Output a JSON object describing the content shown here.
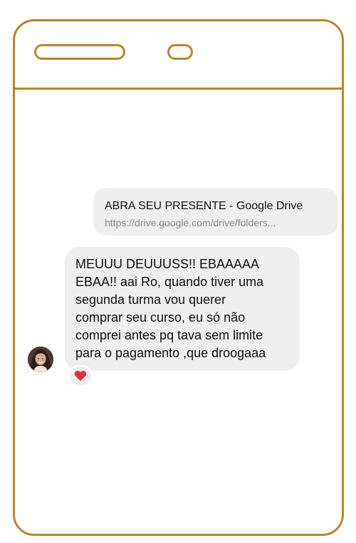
{
  "colors": {
    "frame": "#b8862a",
    "bubble": "#efefef",
    "text": "#111111",
    "secondary_text": "#8a8a8a",
    "heart": "#e0303e"
  },
  "phone": {
    "speaker_icon": "speaker-slot-icon",
    "camera_icon": "camera-slot-icon"
  },
  "chat": {
    "link_preview": {
      "title": "ABRA SEU PRESENTE - Google Drive",
      "url": "https://drive.google.com/drive/folders..."
    },
    "reply": {
      "text": "MEUUU DEUUUSS!! EBAAAAA\nEBAA!! aai Ro, quando tiver uma\nsegunda turma vou querer\ncomprar seu curso, eu só não\ncomprei antes pq tava sem limite\npara o pagamento ,que droogaaa",
      "avatar_icon": "user-avatar-icon",
      "reaction_icon": "heart-icon"
    }
  }
}
